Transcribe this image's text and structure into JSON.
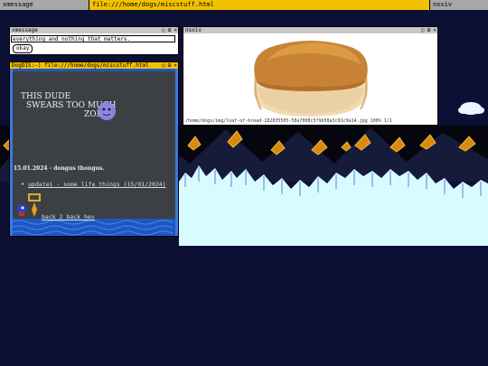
{
  "topbar": {
    "left": "xmessage",
    "center": "file:///home/dogs/miscstuff.html",
    "right": "nsxiv"
  },
  "xmessage": {
    "title": "xmessage",
    "message": "everything and nothing that matters.",
    "button": "okay"
  },
  "nsxiv": {
    "title": "nsxiv",
    "status": "/home/dogs/img/loaf-of-bread-182835505-58a7008c5f9b58a3c91c9a14.jpg  100%  1/1"
  },
  "browser": {
    "title": "DogDIS:-) file:///home/dogs/miscstuff.html",
    "heading_line1": "THIS DUDE",
    "heading_line2": "SWEARS TOO MUCH",
    "heading_line3": "ZONE!",
    "date_entry": "15.01.2024 - dongus thongus.",
    "links": [
      "update1 - some life things (15/01/2024)",
      "back 2 back hev"
    ]
  },
  "window_buttons": [
    "○",
    "⊞",
    "×"
  ],
  "colors": {
    "topbar_grey": "#a8a8a8",
    "focus_yellow": "#f2c200",
    "desktop_navy": "#0c1035",
    "sky_cyan": "#d8fbff"
  }
}
